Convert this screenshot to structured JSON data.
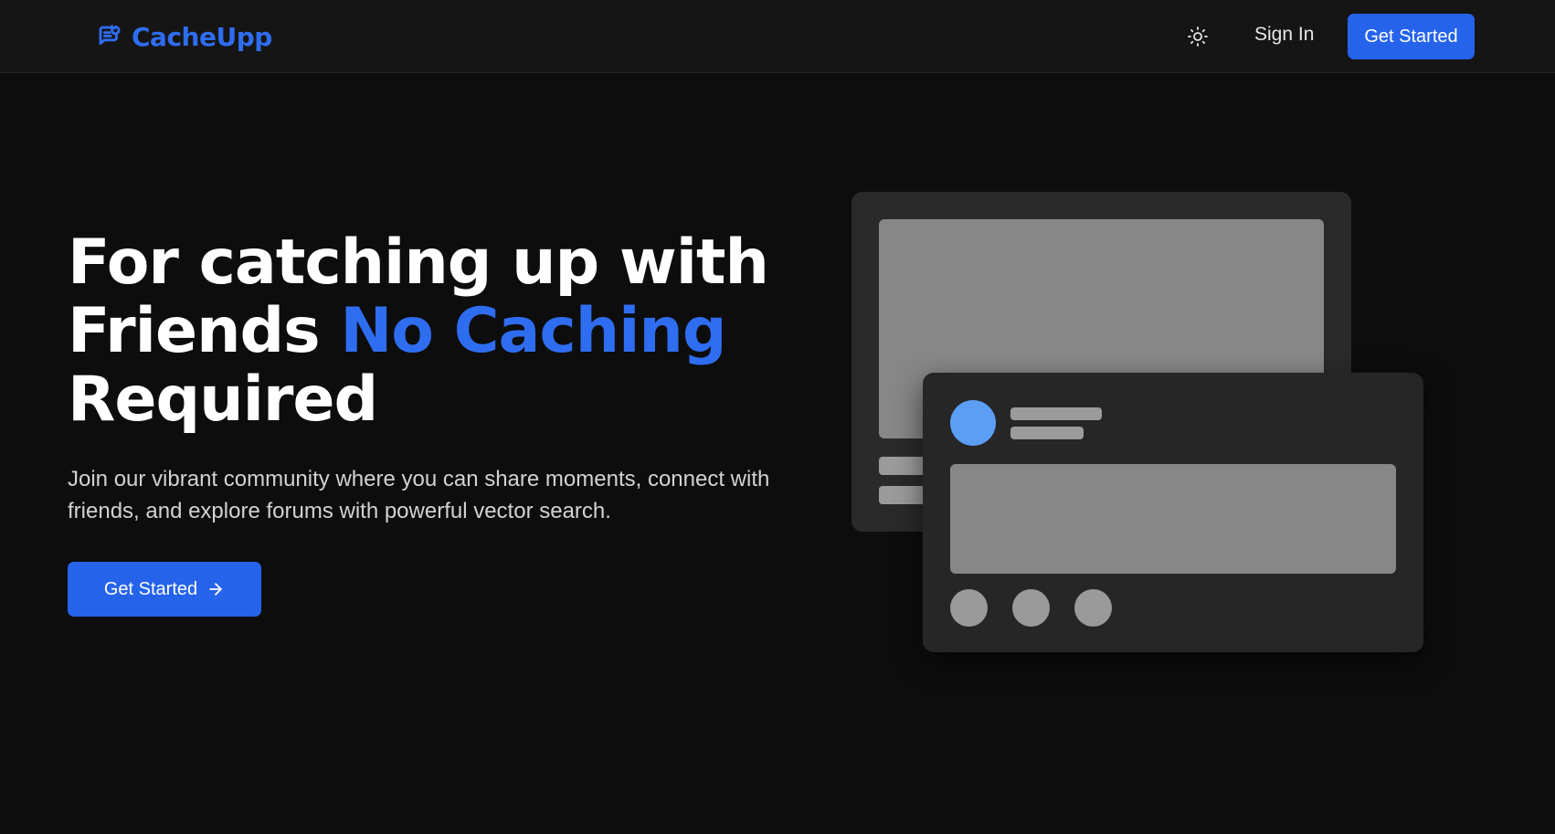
{
  "nav": {
    "brand_name": "CacheUpp",
    "brand_icon": "chat-bubble-refresh-icon",
    "theme_toggle_icon": "sun-icon",
    "signin_label": "Sign In",
    "cta_label": "Get Started"
  },
  "hero": {
    "title_line1": "For catching up with",
    "title_line2_prefix": "Friends ",
    "title_highlight": "No Caching",
    "title_line3": "Required",
    "subtitle": "Join our vibrant community where you can share moments, connect with friends, and explore forums with powerful vector search.",
    "cta_label": "Get Started",
    "cta_icon": "arrow-right-icon"
  },
  "colors": {
    "background": "#0d0d0d",
    "navbar": "#151515",
    "accent": "#2563eb",
    "brand_text": "#2f6df0",
    "card": "#2a2a2a",
    "placeholder": "#878787",
    "avatar": "#5b9ef4"
  }
}
